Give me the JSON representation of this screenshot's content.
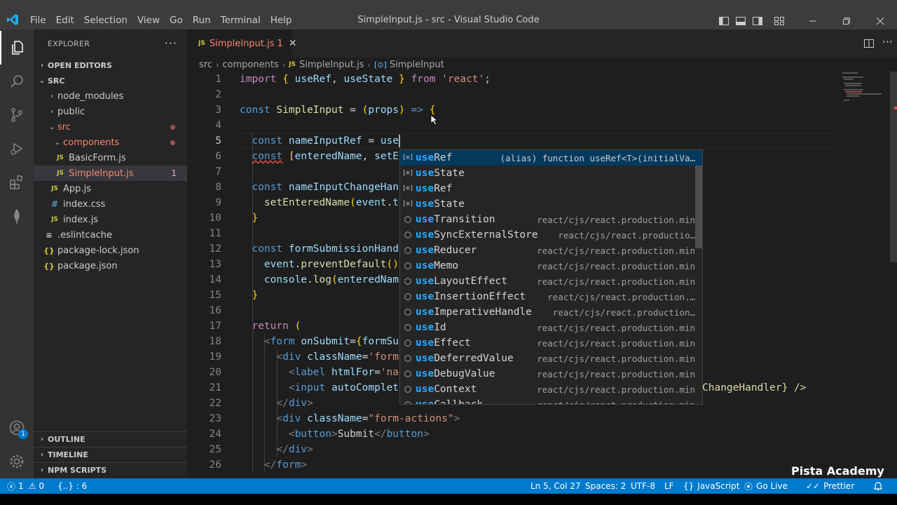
{
  "window": {
    "title": "SimpleInput.js - src - Visual Studio Code",
    "menu": [
      "File",
      "Edit",
      "Selection",
      "View",
      "Go",
      "Run",
      "Terminal",
      "Help"
    ]
  },
  "activity_bar": {
    "items": [
      "explorer-icon",
      "search-icon",
      "source-control-icon",
      "run-debug-icon",
      "extensions-icon",
      "mongodb-icon"
    ],
    "accounts_badge": "1"
  },
  "sidebar": {
    "title": "EXPLORER",
    "more": "···",
    "open_editors": "OPEN EDITORS",
    "root": "SRC",
    "tree": [
      {
        "label": "node_modules",
        "kind": "folder",
        "state": "collapsed"
      },
      {
        "label": "public",
        "kind": "folder",
        "state": "collapsed"
      },
      {
        "label": "src",
        "kind": "folder",
        "state": "expanded"
      },
      {
        "label": "components",
        "kind": "folder",
        "state": "expanded"
      },
      {
        "label": "BasicForm.js",
        "kind": "js"
      },
      {
        "label": "SimpleInput.js",
        "kind": "js",
        "error_count": "1"
      },
      {
        "label": "App.js",
        "kind": "js"
      },
      {
        "label": "index.css",
        "kind": "css"
      },
      {
        "label": "index.js",
        "kind": "js"
      },
      {
        "label": ".eslintcache",
        "kind": "file"
      },
      {
        "label": "package-lock.json",
        "kind": "json"
      },
      {
        "label": "package.json",
        "kind": "json"
      }
    ],
    "outline": "OUTLINE",
    "timeline": "TIMELINE",
    "npm_scripts": "NPM SCRIPTS"
  },
  "editor": {
    "tab": {
      "icon": "JS",
      "label": "SimpleInput.js",
      "problems": "1",
      "close": "✕"
    },
    "breadcrumb": [
      "src",
      "components",
      "SimpleInput.js",
      "SimpleInput"
    ],
    "lines": [
      "import { useRef, useState } from 'react';",
      "",
      "const SimpleInput = (props) => {",
      "",
      "  const nameInputRef = use",
      "  const [enteredName, setE",
      "",
      "  const nameInputChangeHan",
      "    setEnteredName(event.t",
      "  }",
      "",
      "  const formSubmissionHand",
      "    event.preventDefault()",
      "    console.log(enteredNam",
      "  }",
      "",
      "  return (",
      "    <form onSubmit={formSu",
      "      <div className='form",
      "        <label htmlFor='na",
      "        <input autoComplet",
      "      </div>",
      "      <div className=\"form-actions\">",
      "        <button>Submit</button>",
      "      </div>",
      "    </form>"
    ],
    "line_numbers": [
      "1",
      "2",
      "3",
      "4",
      "5",
      "6",
      "7",
      "8",
      "9",
      "10",
      "11",
      "12",
      "13",
      "14",
      "15",
      "16",
      "17",
      "18",
      "19",
      "20",
      "21",
      "22",
      "23",
      "24",
      "25",
      "26"
    ],
    "current_line": "5",
    "line21_tail": "ChangeHandler} />"
  },
  "suggest": {
    "typed": "use",
    "items": [
      {
        "label": "useRef",
        "icon": "variable-icon",
        "detail": "(alias) function useRef<T>(initialVa…"
      },
      {
        "label": "useState",
        "icon": "variable-icon",
        "detail": ""
      },
      {
        "label": "useRef",
        "icon": "variable-icon",
        "detail": ""
      },
      {
        "label": "useState",
        "icon": "variable-icon",
        "detail": ""
      },
      {
        "label": "useTransition",
        "icon": "module-icon",
        "detail": "react/cjs/react.production.min"
      },
      {
        "label": "useSyncExternalStore",
        "icon": "module-icon",
        "detail": "react/cjs/react.productio…"
      },
      {
        "label": "useReducer",
        "icon": "module-icon",
        "detail": "react/cjs/react.production.min"
      },
      {
        "label": "useMemo",
        "icon": "module-icon",
        "detail": "react/cjs/react.production.min"
      },
      {
        "label": "useLayoutEffect",
        "icon": "module-icon",
        "detail": "react/cjs/react.production.min"
      },
      {
        "label": "useInsertionEffect",
        "icon": "module-icon",
        "detail": "react/cjs/react.production.…"
      },
      {
        "label": "useImperativeHandle",
        "icon": "module-icon",
        "detail": "react/cjs/react.production…"
      },
      {
        "label": "useId",
        "icon": "module-icon",
        "detail": "react/cjs/react.production.min"
      },
      {
        "label": "useEffect",
        "icon": "module-icon",
        "detail": "react/cjs/react.production.min"
      },
      {
        "label": "useDeferredValue",
        "icon": "module-icon",
        "detail": "react/cjs/react.production.min"
      },
      {
        "label": "useDebugValue",
        "icon": "module-icon",
        "detail": "react/cjs/react.production.min"
      },
      {
        "label": "useContext",
        "icon": "module-icon",
        "detail": "react/cjs/react.production.min"
      },
      {
        "label": "useCallback",
        "icon": "module-icon",
        "detail": "react/cjs/react.production.min"
      }
    ]
  },
  "status_bar": {
    "errors": "1",
    "warnings": "0",
    "braces": "{..} : 6",
    "position": "Ln 5, Col 27",
    "spaces": "Spaces: 2",
    "encoding": "UTF-8",
    "eol": "LF",
    "language": "JavaScript",
    "go_live": "Go Live",
    "prettier": "Prettier"
  },
  "watermark": "Pista Academy",
  "colors": {
    "accent": "#007acc",
    "titlebar": "#3c3c3c",
    "sidebar": "#252526",
    "editor": "#1e1e1e",
    "error": "#f48771"
  }
}
